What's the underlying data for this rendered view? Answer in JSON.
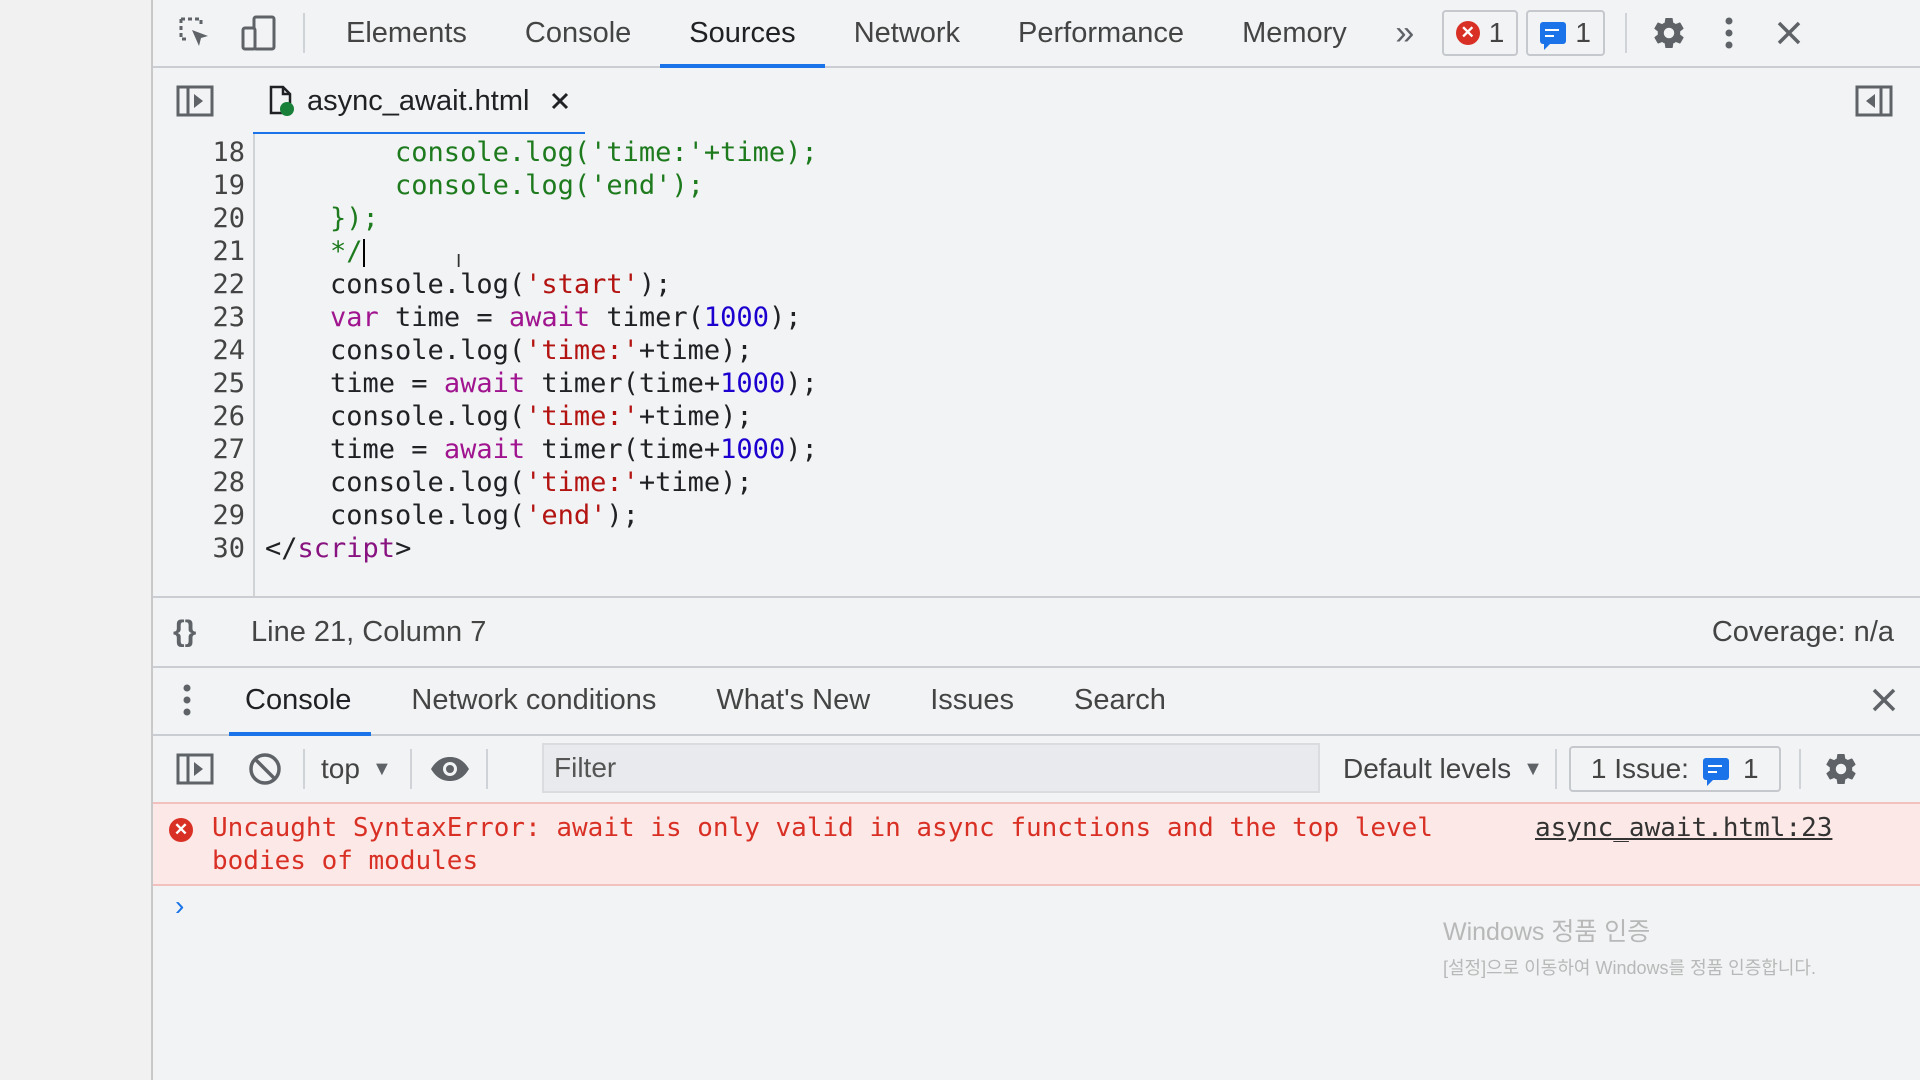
{
  "toolbar": {
    "tabs": [
      "Elements",
      "Console",
      "Sources",
      "Network",
      "Performance",
      "Memory"
    ],
    "active_tab": "Sources",
    "error_count": "1",
    "message_count": "1",
    "accent": "#1a73e8"
  },
  "file_tab": {
    "name": "async_await.html"
  },
  "editor": {
    "lines": [
      {
        "num": "18",
        "parts": [
          [
            "c-green",
            "        console.log('time:'+time);"
          ]
        ]
      },
      {
        "num": "19",
        "parts": [
          [
            "c-green",
            "        console.log('end');"
          ]
        ]
      },
      {
        "num": "20",
        "parts": [
          [
            "c-green",
            "    });"
          ]
        ]
      },
      {
        "num": "21",
        "parts": [
          [
            "c-green",
            "    */"
          ]
        ],
        "caret": true
      },
      {
        "num": "22",
        "parts": [
          [
            "c-plain",
            "    console.log("
          ],
          [
            "c-str",
            "'start'"
          ],
          [
            "c-plain",
            ");"
          ]
        ]
      },
      {
        "num": "23",
        "parts": [
          [
            "c-kw",
            "    var"
          ],
          [
            "c-plain",
            " time = "
          ],
          [
            "c-kw",
            "await"
          ],
          [
            "c-plain",
            " timer("
          ],
          [
            "c-num",
            "1000"
          ],
          [
            "c-plain",
            ");"
          ]
        ]
      },
      {
        "num": "24",
        "parts": [
          [
            "c-plain",
            "    console.log("
          ],
          [
            "c-str",
            "'time:'"
          ],
          [
            "c-plain",
            "+time);"
          ]
        ]
      },
      {
        "num": "25",
        "parts": [
          [
            "c-plain",
            "    time = "
          ],
          [
            "c-kw",
            "await"
          ],
          [
            "c-plain",
            " timer(time+"
          ],
          [
            "c-num",
            "1000"
          ],
          [
            "c-plain",
            ");"
          ]
        ]
      },
      {
        "num": "26",
        "parts": [
          [
            "c-plain",
            "    console.log("
          ],
          [
            "c-str",
            "'time:'"
          ],
          [
            "c-plain",
            "+time);"
          ]
        ]
      },
      {
        "num": "27",
        "parts": [
          [
            "c-plain",
            "    time = "
          ],
          [
            "c-kw",
            "await"
          ],
          [
            "c-plain",
            " timer(time+"
          ],
          [
            "c-num",
            "1000"
          ],
          [
            "c-plain",
            ");"
          ]
        ]
      },
      {
        "num": "28",
        "parts": [
          [
            "c-plain",
            "    console.log("
          ],
          [
            "c-str",
            "'time:'"
          ],
          [
            "c-plain",
            "+time);"
          ]
        ]
      },
      {
        "num": "29",
        "parts": [
          [
            "c-plain",
            "    console.log("
          ],
          [
            "c-str",
            "'end'"
          ],
          [
            "c-plain",
            ");"
          ]
        ]
      },
      {
        "num": "30",
        "parts": [
          [
            "c-plain",
            "</"
          ],
          [
            "c-tag",
            "script"
          ],
          [
            "c-plain",
            ">"
          ]
        ]
      }
    ]
  },
  "status": {
    "format_icon": "{}",
    "position": "Line 21, Column 7",
    "coverage": "Coverage: n/a"
  },
  "drawer": {
    "tabs": [
      "Console",
      "Network conditions",
      "What's New",
      "Issues",
      "Search"
    ],
    "active_tab": "Console"
  },
  "console_toolbar": {
    "context": "top",
    "filter_placeholder": "Filter",
    "levels": "Default levels",
    "issues_label": "1 Issue:",
    "issues_count": "1"
  },
  "console": {
    "error_text": "Uncaught SyntaxError: await is only valid in async functions and the top level bodies of modules",
    "error_source": "async_await.html:23",
    "prompt": "›"
  },
  "watermark": {
    "line1": "Windows 정품 인증",
    "line2": "[설정]으로 이동하여 Windows를 정품 인증합니다."
  }
}
